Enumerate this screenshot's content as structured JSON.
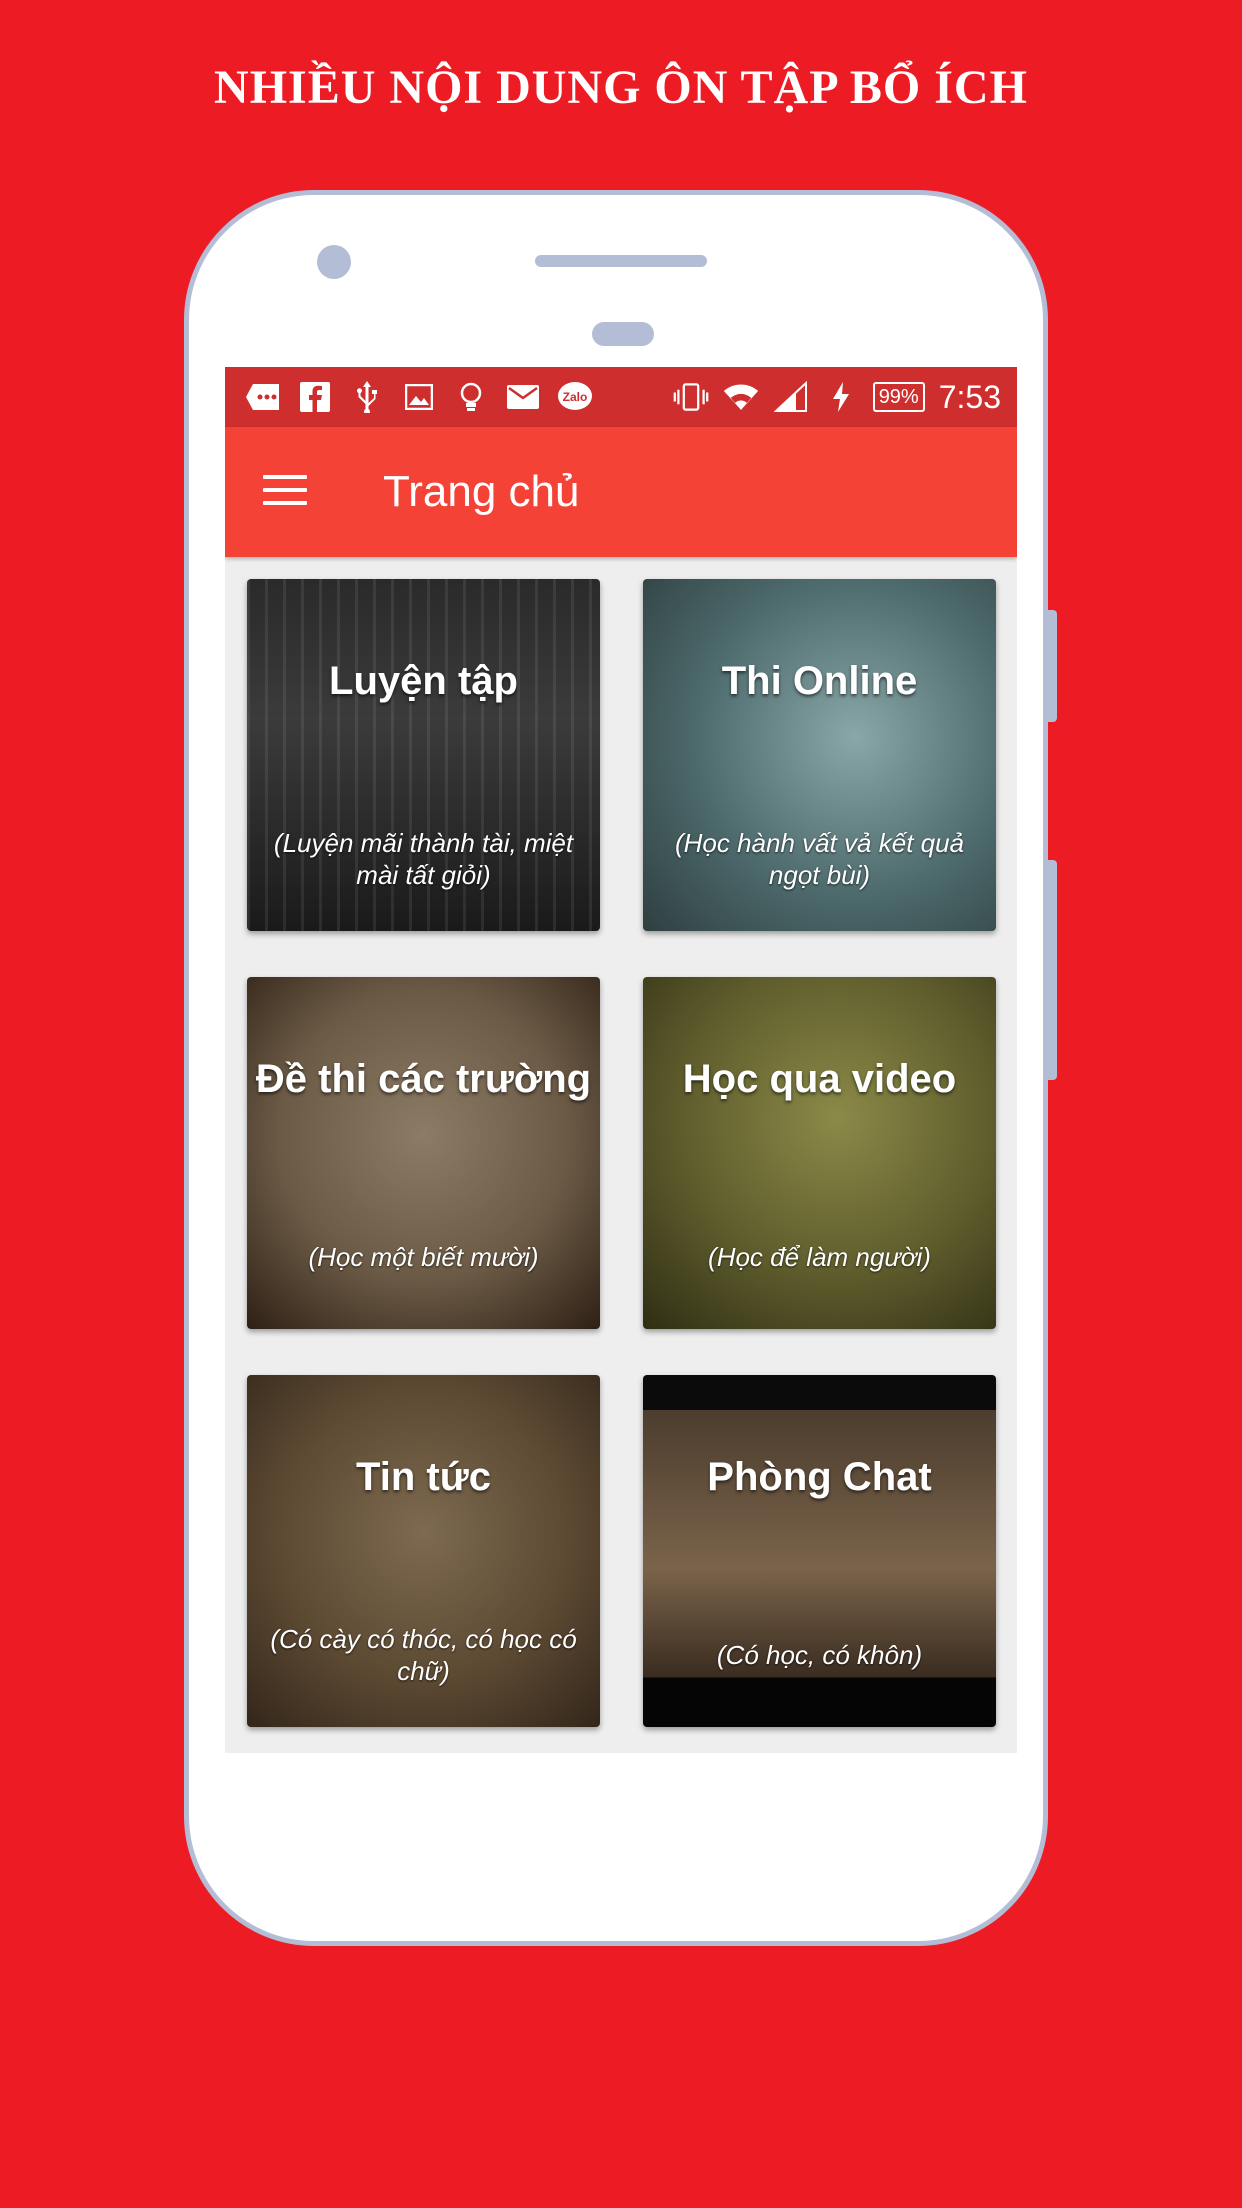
{
  "promo": {
    "title": "NHIỀU NỘI DUNG ÔN TẬP BỔ ÍCH"
  },
  "status_bar": {
    "battery": "99%",
    "time": "7:53",
    "left_icons": [
      "messages-icon",
      "facebook-icon",
      "usb-icon",
      "image-icon",
      "lightbulb-icon",
      "mail-icon",
      "zalo-icon"
    ],
    "right_icons": [
      "vibrate-icon",
      "wifi-icon",
      "signal-icon",
      "charging-icon"
    ]
  },
  "app_bar": {
    "title": "Trang chủ"
  },
  "cards": [
    {
      "title": "Luyện tập",
      "subtitle": "(Luyện mãi thành tài, miệt mài tất giỏi)"
    },
    {
      "title": "Thi Online",
      "subtitle": "(Học hành vất vả kết quả ngọt bùi)"
    },
    {
      "title": "Đề thi các trường",
      "subtitle": "(Học một biết mười)"
    },
    {
      "title": "Học qua video",
      "subtitle": "(Học để làm người)"
    },
    {
      "title": "Tin tức",
      "subtitle": "(Có cày có thóc, có học có chữ)"
    },
    {
      "title": "Phòng Chat",
      "subtitle": "(Có học, có khôn)"
    }
  ],
  "colors": {
    "background": "#ed1c24",
    "status_bar": "#cf2e2e",
    "app_bar": "#f44336",
    "phone_frame": "#b3bdd6"
  }
}
